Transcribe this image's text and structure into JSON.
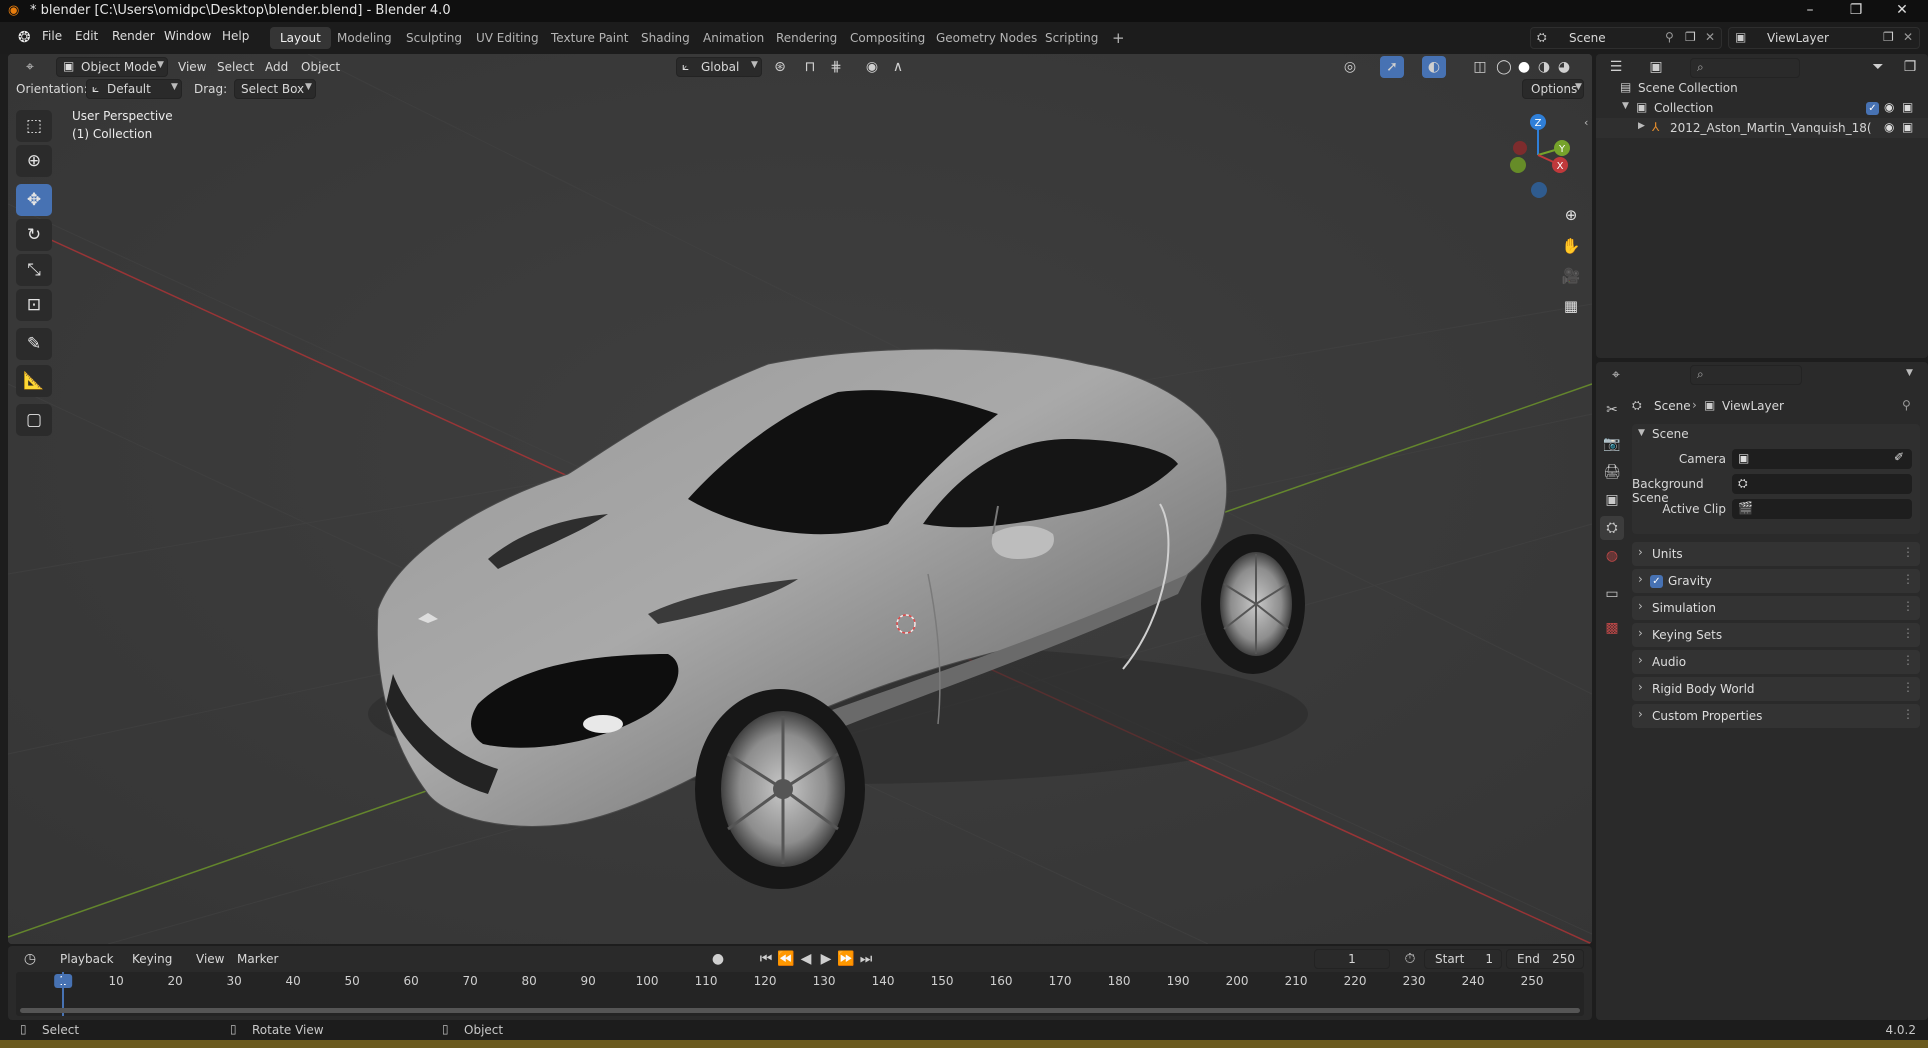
{
  "titlebar": {
    "title": "* blender [C:\\Users\\omidpc\\Desktop\\blender.blend] - Blender 4.0",
    "minimize": "–",
    "restore": "❐",
    "close": "✕"
  },
  "menu": [
    "File",
    "Edit",
    "Render",
    "Window",
    "Help"
  ],
  "workspaces": [
    "Layout",
    "Modeling",
    "Sculpting",
    "UV Editing",
    "Texture Paint",
    "Shading",
    "Animation",
    "Rendering",
    "Compositing",
    "Geometry Nodes",
    "Scripting"
  ],
  "workspace_add": "+",
  "scene_selector": "Scene",
  "viewlayer_selector": "ViewLayer",
  "viewport": {
    "mode": "Object Mode",
    "menus": [
      "View",
      "Select",
      "Add",
      "Object"
    ],
    "transform_orientation": "Global",
    "orientation_label": "Orientation:",
    "orientation_value": "Default",
    "drag_label": "Drag:",
    "drag_value": "Select Box",
    "options": "Options",
    "overlay_title": "User Perspective",
    "overlay_collection": "(1) Collection",
    "gizmo": {
      "z": "Z",
      "y": "Y",
      "x": "X"
    }
  },
  "outliner": {
    "root": "Scene Collection",
    "collection": "Collection",
    "object": "2012_Aston_Martin_Vanquish_18("
  },
  "properties": {
    "breadcrumb_scene": "Scene",
    "breadcrumb_viewlayer": "ViewLayer",
    "section_scene": "Scene",
    "fields": [
      {
        "label": "Camera",
        "value": ""
      },
      {
        "label": "Background Scene",
        "value": ""
      },
      {
        "label": "Active Clip",
        "value": ""
      }
    ],
    "sections": [
      "Units",
      "Gravity",
      "Simulation",
      "Keying Sets",
      "Audio",
      "Rigid Body World",
      "Custom Properties"
    ],
    "gravity_checked": true
  },
  "timeline": {
    "menus": [
      "Playback",
      "Keying",
      "View",
      "Marker"
    ],
    "current_frame": "1",
    "start_label": "Start",
    "start_value": "1",
    "end_label": "End",
    "end_value": "250",
    "ticks": [
      "1",
      "10",
      "20",
      "30",
      "40",
      "50",
      "60",
      "70",
      "80",
      "90",
      "100",
      "110",
      "120",
      "130",
      "140",
      "150",
      "160",
      "170",
      "180",
      "190",
      "200",
      "210",
      "220",
      "230",
      "240",
      "250"
    ]
  },
  "statusbar": {
    "select": "Select",
    "rotate": "Rotate View",
    "object": "Object",
    "version": "4.0.2"
  },
  "colors": {
    "accent": "#4772b3",
    "viewport_bg": "#3b3b3b",
    "panel_bg": "#2a2a2a",
    "axis_x": "#c0393b",
    "axis_y": "#76a32b",
    "axis_z": "#2f7fd8"
  }
}
